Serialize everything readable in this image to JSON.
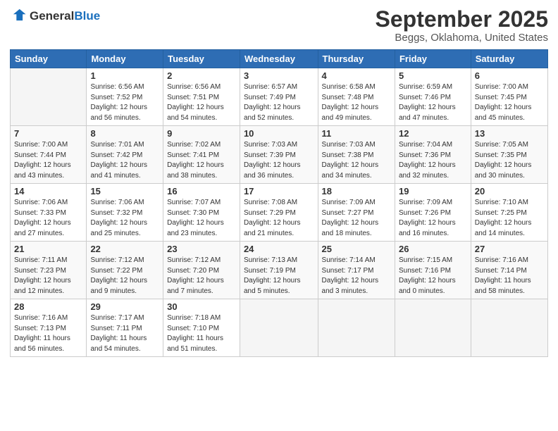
{
  "header": {
    "logo_general": "General",
    "logo_blue": "Blue",
    "title": "September 2025",
    "subtitle": "Beggs, Oklahoma, United States"
  },
  "calendar": {
    "days_of_week": [
      "Sunday",
      "Monday",
      "Tuesday",
      "Wednesday",
      "Thursday",
      "Friday",
      "Saturday"
    ],
    "weeks": [
      [
        {
          "day": "",
          "info": ""
        },
        {
          "day": "1",
          "info": "Sunrise: 6:56 AM\nSunset: 7:52 PM\nDaylight: 12 hours\nand 56 minutes."
        },
        {
          "day": "2",
          "info": "Sunrise: 6:56 AM\nSunset: 7:51 PM\nDaylight: 12 hours\nand 54 minutes."
        },
        {
          "day": "3",
          "info": "Sunrise: 6:57 AM\nSunset: 7:49 PM\nDaylight: 12 hours\nand 52 minutes."
        },
        {
          "day": "4",
          "info": "Sunrise: 6:58 AM\nSunset: 7:48 PM\nDaylight: 12 hours\nand 49 minutes."
        },
        {
          "day": "5",
          "info": "Sunrise: 6:59 AM\nSunset: 7:46 PM\nDaylight: 12 hours\nand 47 minutes."
        },
        {
          "day": "6",
          "info": "Sunrise: 7:00 AM\nSunset: 7:45 PM\nDaylight: 12 hours\nand 45 minutes."
        }
      ],
      [
        {
          "day": "7",
          "info": "Sunrise: 7:00 AM\nSunset: 7:44 PM\nDaylight: 12 hours\nand 43 minutes."
        },
        {
          "day": "8",
          "info": "Sunrise: 7:01 AM\nSunset: 7:42 PM\nDaylight: 12 hours\nand 41 minutes."
        },
        {
          "day": "9",
          "info": "Sunrise: 7:02 AM\nSunset: 7:41 PM\nDaylight: 12 hours\nand 38 minutes."
        },
        {
          "day": "10",
          "info": "Sunrise: 7:03 AM\nSunset: 7:39 PM\nDaylight: 12 hours\nand 36 minutes."
        },
        {
          "day": "11",
          "info": "Sunrise: 7:03 AM\nSunset: 7:38 PM\nDaylight: 12 hours\nand 34 minutes."
        },
        {
          "day": "12",
          "info": "Sunrise: 7:04 AM\nSunset: 7:36 PM\nDaylight: 12 hours\nand 32 minutes."
        },
        {
          "day": "13",
          "info": "Sunrise: 7:05 AM\nSunset: 7:35 PM\nDaylight: 12 hours\nand 30 minutes."
        }
      ],
      [
        {
          "day": "14",
          "info": "Sunrise: 7:06 AM\nSunset: 7:33 PM\nDaylight: 12 hours\nand 27 minutes."
        },
        {
          "day": "15",
          "info": "Sunrise: 7:06 AM\nSunset: 7:32 PM\nDaylight: 12 hours\nand 25 minutes."
        },
        {
          "day": "16",
          "info": "Sunrise: 7:07 AM\nSunset: 7:30 PM\nDaylight: 12 hours\nand 23 minutes."
        },
        {
          "day": "17",
          "info": "Sunrise: 7:08 AM\nSunset: 7:29 PM\nDaylight: 12 hours\nand 21 minutes."
        },
        {
          "day": "18",
          "info": "Sunrise: 7:09 AM\nSunset: 7:27 PM\nDaylight: 12 hours\nand 18 minutes."
        },
        {
          "day": "19",
          "info": "Sunrise: 7:09 AM\nSunset: 7:26 PM\nDaylight: 12 hours\nand 16 minutes."
        },
        {
          "day": "20",
          "info": "Sunrise: 7:10 AM\nSunset: 7:25 PM\nDaylight: 12 hours\nand 14 minutes."
        }
      ],
      [
        {
          "day": "21",
          "info": "Sunrise: 7:11 AM\nSunset: 7:23 PM\nDaylight: 12 hours\nand 12 minutes."
        },
        {
          "day": "22",
          "info": "Sunrise: 7:12 AM\nSunset: 7:22 PM\nDaylight: 12 hours\nand 9 minutes."
        },
        {
          "day": "23",
          "info": "Sunrise: 7:12 AM\nSunset: 7:20 PM\nDaylight: 12 hours\nand 7 minutes."
        },
        {
          "day": "24",
          "info": "Sunrise: 7:13 AM\nSunset: 7:19 PM\nDaylight: 12 hours\nand 5 minutes."
        },
        {
          "day": "25",
          "info": "Sunrise: 7:14 AM\nSunset: 7:17 PM\nDaylight: 12 hours\nand 3 minutes."
        },
        {
          "day": "26",
          "info": "Sunrise: 7:15 AM\nSunset: 7:16 PM\nDaylight: 12 hours\nand 0 minutes."
        },
        {
          "day": "27",
          "info": "Sunrise: 7:16 AM\nSunset: 7:14 PM\nDaylight: 11 hours\nand 58 minutes."
        }
      ],
      [
        {
          "day": "28",
          "info": "Sunrise: 7:16 AM\nSunset: 7:13 PM\nDaylight: 11 hours\nand 56 minutes."
        },
        {
          "day": "29",
          "info": "Sunrise: 7:17 AM\nSunset: 7:11 PM\nDaylight: 11 hours\nand 54 minutes."
        },
        {
          "day": "30",
          "info": "Sunrise: 7:18 AM\nSunset: 7:10 PM\nDaylight: 11 hours\nand 51 minutes."
        },
        {
          "day": "",
          "info": ""
        },
        {
          "day": "",
          "info": ""
        },
        {
          "day": "",
          "info": ""
        },
        {
          "day": "",
          "info": ""
        }
      ]
    ]
  }
}
